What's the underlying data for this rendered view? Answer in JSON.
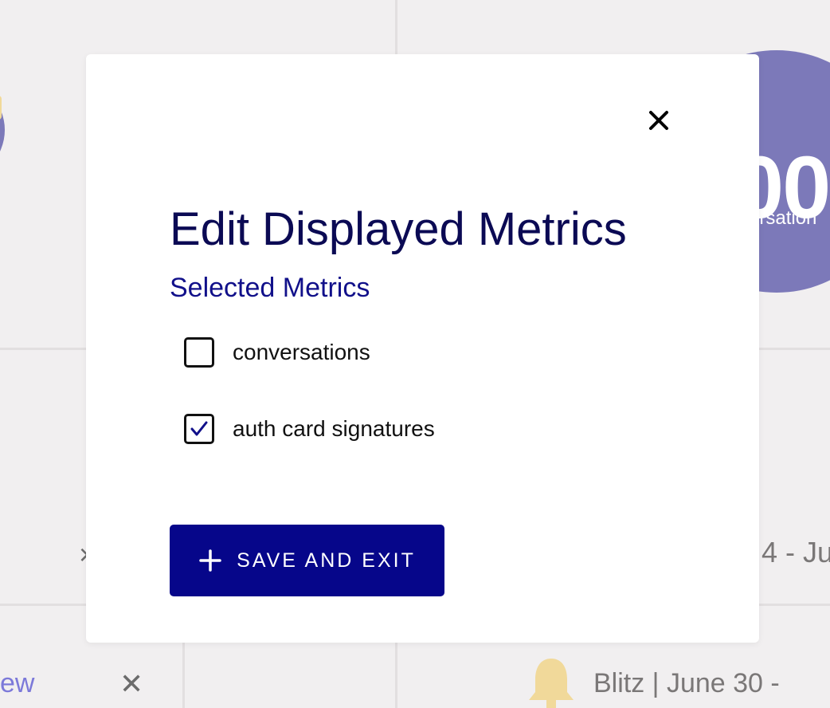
{
  "background": {
    "metric_circle": {
      "value_fragment": "00",
      "label_fragment": "ersation"
    },
    "date_fragment": "4 - Ju",
    "link_fragment": "ew",
    "event_text": "Blitz | June 30 -",
    "colors": {
      "page_bg": "#f1eff0",
      "circle": "#7c79b9",
      "bell": "#f1d99a"
    }
  },
  "modal": {
    "title": "Edit Displayed Metrics",
    "section_label": "Selected Metrics",
    "options": [
      {
        "label": "conversations",
        "checked": false
      },
      {
        "label": "auth card signatures",
        "checked": true
      }
    ],
    "save_button_label": "SAVE AND EXIT",
    "colors": {
      "title": "#0b0a54",
      "section_label": "#11108a",
      "button_bg": "#06068a",
      "check": "#11108a"
    },
    "icons": {
      "close": "close-icon",
      "check": "checkmark-icon",
      "plus": "plus-icon"
    }
  }
}
